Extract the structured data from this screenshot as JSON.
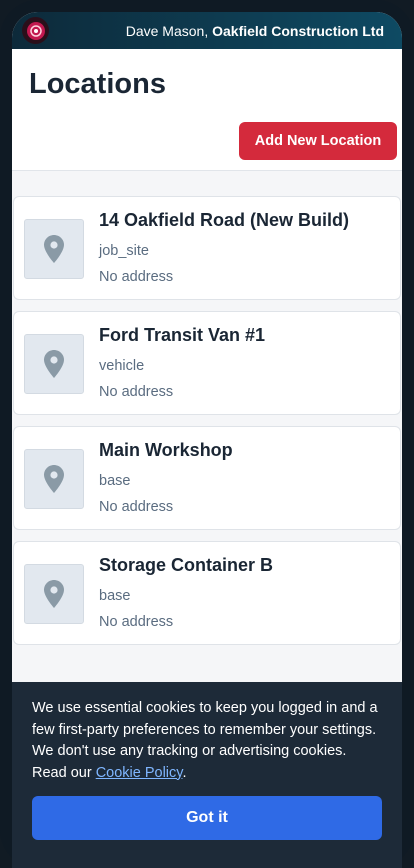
{
  "header": {
    "user_name": "Dave Mason,",
    "company": "Oakfield Construction Ltd"
  },
  "page": {
    "title": "Locations",
    "add_button": "Add New Location"
  },
  "locations": [
    {
      "name": "14 Oakfield Road (New Build)",
      "type": "job_site",
      "address": "No address"
    },
    {
      "name": "Ford Transit Van #1",
      "type": "vehicle",
      "address": "No address"
    },
    {
      "name": "Main Workshop",
      "type": "base",
      "address": "No address"
    },
    {
      "name": "Storage Container B",
      "type": "base",
      "address": "No address"
    }
  ],
  "cookie_banner": {
    "text": "We use essential cookies to keep you logged in and a few first-party preferences to remember your settings. We don't use any tracking or advertising cookies. Read our",
    "link": "Cookie Policy",
    "after_link": ".",
    "button": "Got it"
  },
  "icons": {
    "logo": "app-logo",
    "location": "map-pin-icon"
  },
  "colors": {
    "primary_red": "#d42a3c",
    "primary_blue": "#2f6ae6",
    "header_dark": "#0d2a3a"
  }
}
